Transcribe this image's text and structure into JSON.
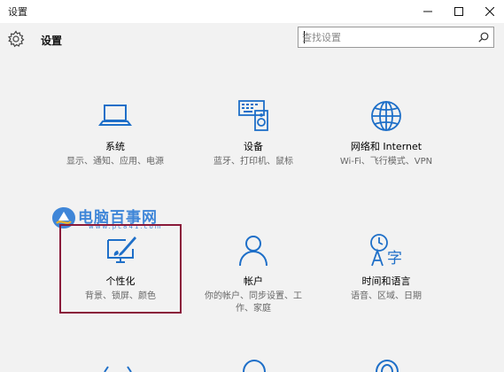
{
  "window": {
    "title": "设置",
    "colors": {
      "accent": "#1e6fc8",
      "selection_border": "#8a1a3a",
      "watermark": "#3f86d8"
    }
  },
  "header": {
    "title": "设置",
    "icon": "gear-icon"
  },
  "search": {
    "placeholder": "查找设置",
    "icon": "search-icon"
  },
  "tiles": [
    {
      "name": "系统",
      "desc": "显示、通知、应用、电源",
      "icon": "laptop-icon"
    },
    {
      "name": "设备",
      "desc": "蓝牙、打印机、鼠标",
      "icon": "devices-icon"
    },
    {
      "name": "网络和 Internet",
      "desc": "Wi-Fi、飞行模式、VPN",
      "icon": "globe-icon"
    },
    {
      "name": "个性化",
      "desc": "背景、锁屏、颜色",
      "icon": "paintbrush-icon"
    },
    {
      "name": "帐户",
      "desc": "你的帐户、同步设置、工作、家庭",
      "icon": "user-icon"
    },
    {
      "name": "时间和语言",
      "desc": "语音、区域、日期",
      "icon": "time-language-icon"
    }
  ],
  "watermark": {
    "text": "电脑百事网",
    "url": "www.pc841.com"
  }
}
